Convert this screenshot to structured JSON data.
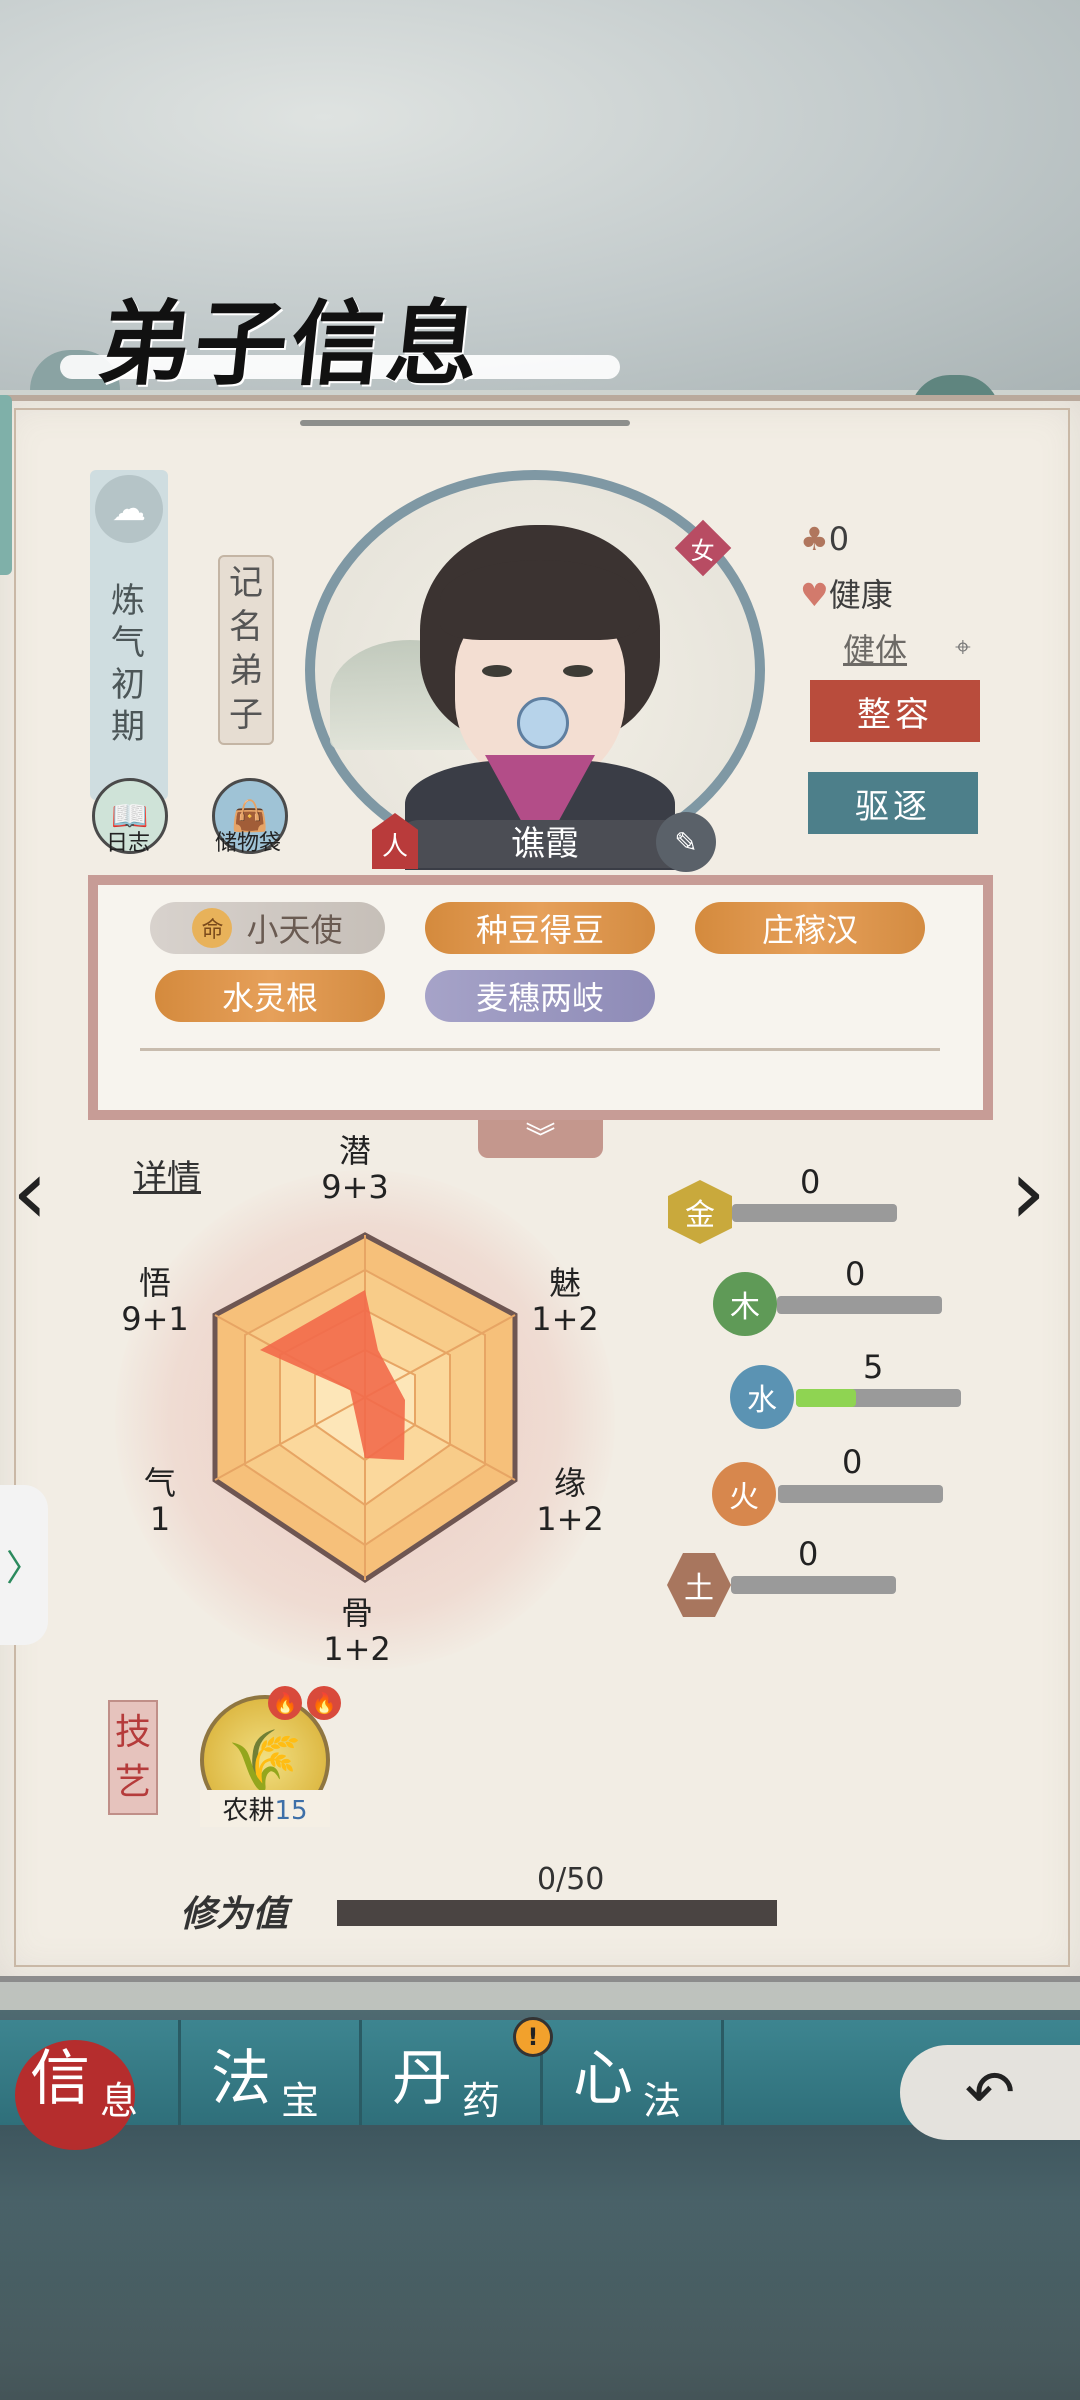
{
  "header": {
    "title": "弟子信息"
  },
  "realm": {
    "text": "炼气初期"
  },
  "rank": {
    "text": "记名弟子"
  },
  "left_buttons": [
    {
      "label": "日志"
    },
    {
      "label": "储物袋"
    }
  ],
  "disciple": {
    "name": "谯霞",
    "gender": "女",
    "person_badge": "人"
  },
  "stats": {
    "count": "0",
    "health": "健康",
    "body_type": "健体"
  },
  "actions": {
    "makeover": "整容",
    "expel": "驱逐"
  },
  "traits": [
    {
      "label": "小天使",
      "style": "gray",
      "prefix": "命"
    },
    {
      "label": "种豆得豆",
      "style": "orange"
    },
    {
      "label": "庄稼汉",
      "style": "orange"
    },
    {
      "label": "水灵根",
      "style": "orange"
    },
    {
      "label": "麦穗两岐",
      "style": "purple"
    }
  ],
  "details_link": "详情",
  "attributes": {
    "qian": {
      "name": "潜",
      "value": "9+3"
    },
    "mei": {
      "name": "魅",
      "value": "1+2"
    },
    "yuan": {
      "name": "缘",
      "value": "1+2"
    },
    "gu": {
      "name": "骨",
      "value": "1+2"
    },
    "qi": {
      "name": "气",
      "value": "1"
    },
    "wu": {
      "name": "悟",
      "value": "9+1"
    }
  },
  "elements": [
    {
      "name": "金",
      "value": "0",
      "color": "#c9a93c"
    },
    {
      "name": "木",
      "value": "0",
      "color": "#5f9a57"
    },
    {
      "name": "水",
      "value": "5",
      "color": "#5b93b3"
    },
    {
      "name": "火",
      "value": "0",
      "color": "#d7874d"
    },
    {
      "name": "土",
      "value": "0",
      "color": "#a8765e"
    }
  ],
  "skills": {
    "section_label": "技艺",
    "items": [
      {
        "name": "农耕",
        "level": "15"
      }
    ]
  },
  "cultivation": {
    "label": "修为值",
    "value": "0/50",
    "progress": 0
  },
  "nav": [
    {
      "big": "信",
      "small": "息"
    },
    {
      "big": "法",
      "small": "宝"
    },
    {
      "big": "丹",
      "small": "药"
    },
    {
      "big": "心",
      "small": "法"
    }
  ],
  "nav_warning": "!",
  "colors": {
    "accent_red": "#b93b3b",
    "teal": "#3d8590",
    "panel": "#f2ede4",
    "water_green": "#8fd452"
  }
}
